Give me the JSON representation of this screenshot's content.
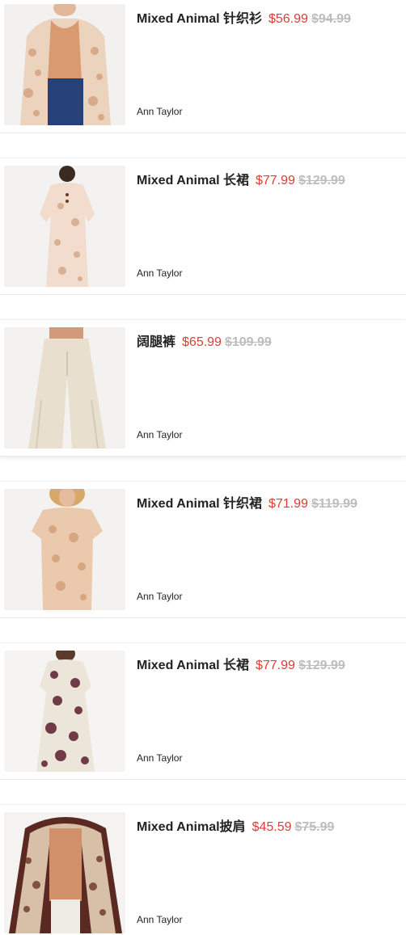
{
  "products": [
    {
      "name": "Mixed Animal 针织衫",
      "price": "$56.99",
      "original_price": "$94.99",
      "brand": "Ann Taylor",
      "image_icon": "cardigan-photo"
    },
    {
      "name": "Mixed Animal 长裙",
      "price": "$77.99",
      "original_price": "$129.99",
      "brand": "Ann Taylor",
      "image_icon": "dress-photo"
    },
    {
      "name": "阔腿裤",
      "price": "$65.99",
      "original_price": "$109.99",
      "brand": "Ann Taylor",
      "image_icon": "wide-leg-pants-photo"
    },
    {
      "name": "Mixed Animal 针织裙",
      "price": "$71.99",
      "original_price": "$119.99",
      "brand": "Ann Taylor",
      "image_icon": "knit-dress-photo"
    },
    {
      "name": "Mixed Animal 长裙",
      "price": "$77.99",
      "original_price": "$129.99",
      "brand": "Ann Taylor",
      "image_icon": "maxi-dress-photo"
    },
    {
      "name": "Mixed Animal披肩",
      "price": "$45.59",
      "original_price": "$75.99",
      "brand": "Ann Taylor",
      "image_icon": "poncho-photo"
    }
  ],
  "colors": {
    "sale_price": "#e53935",
    "original_price": "#bdbdbd",
    "text": "#222222"
  }
}
